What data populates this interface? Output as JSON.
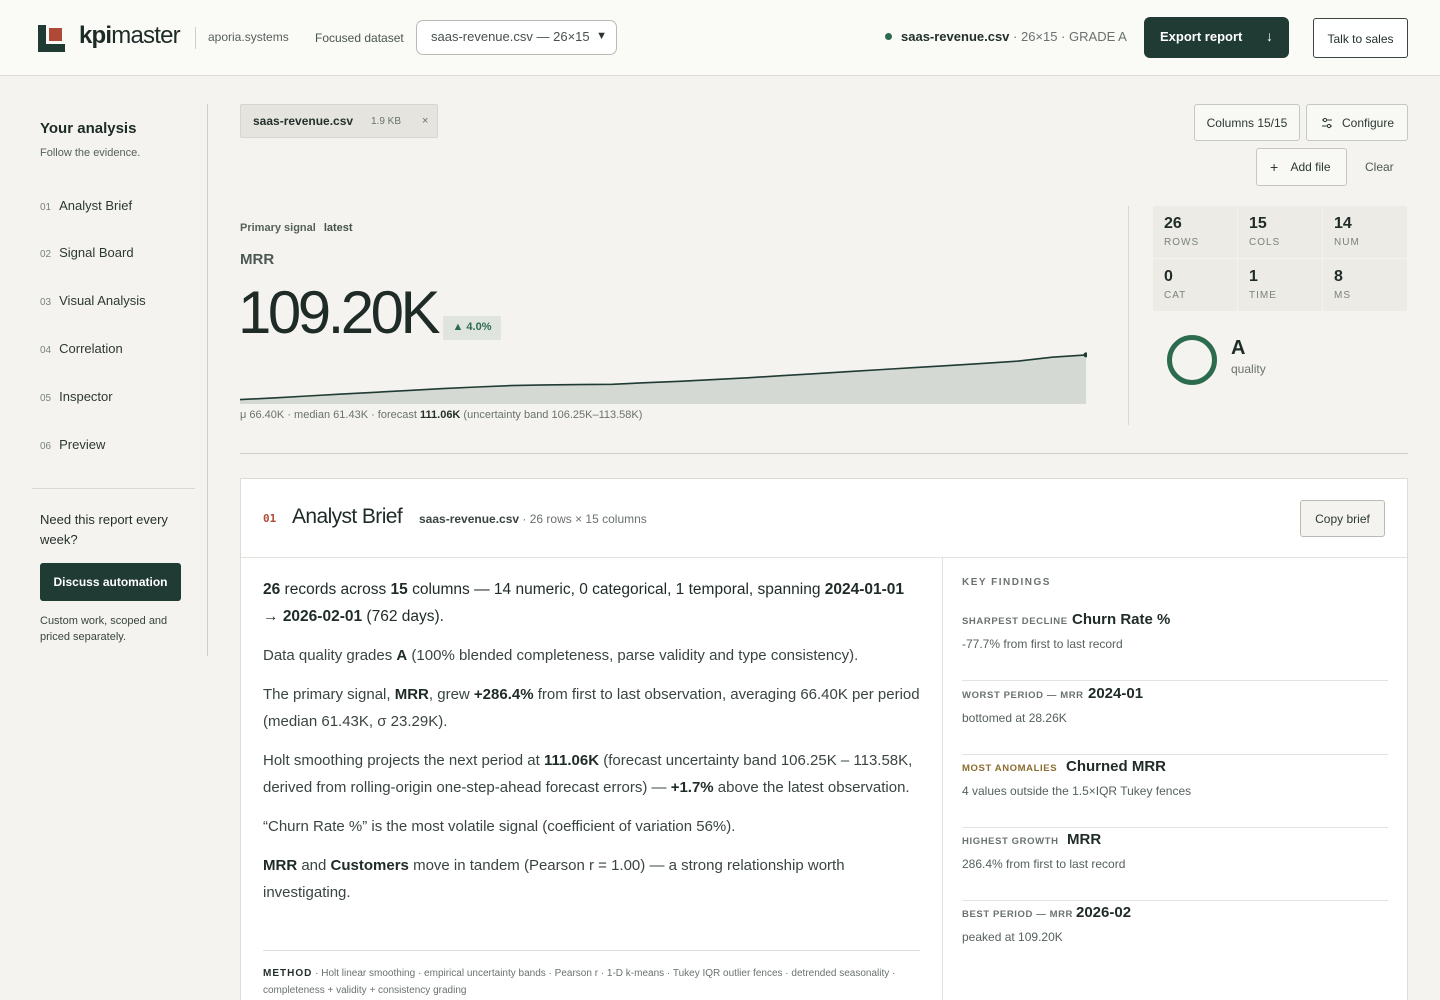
{
  "header": {
    "brand_bold": "kpi",
    "brand_rest": "master",
    "domain": "aporia.systems",
    "dataset_label": "Focused dataset",
    "dataset_selected": "saas-revenue.csv — 26×15",
    "status_file": "saas-revenue.csv",
    "status_meta": " · 26×15 · GRADE A",
    "export_label": "Export report",
    "sales_label": "Talk to sales",
    "colors": {
      "brand_dark": "#1f3b33",
      "accent_red": "#b04a38",
      "accent_green": "#2d6b4f"
    }
  },
  "sidebar": {
    "title": "Your analysis",
    "subtitle": "Follow the evidence.",
    "items": [
      {
        "num": "01",
        "label": "Analyst Brief"
      },
      {
        "num": "02",
        "label": "Signal Board"
      },
      {
        "num": "03",
        "label": "Visual Analysis"
      },
      {
        "num": "04",
        "label": "Correlation"
      },
      {
        "num": "05",
        "label": "Inspector"
      },
      {
        "num": "06",
        "label": "Preview"
      }
    ],
    "cta_text": "Need this report every week?",
    "cta_button": "Discuss automation",
    "cta_note": "Custom work, scoped and priced separately."
  },
  "files": {
    "chip_name": "saas-revenue.csv",
    "chip_size": "1.9 KB",
    "chip_close": "×",
    "columns_button": "Columns 15/15",
    "configure_button": "Configure",
    "add_file_button": "Add file",
    "clear_button": "Clear"
  },
  "primary_signal": {
    "label": "Primary signal",
    "tag": "latest",
    "metric": "MRR",
    "value": "109.20K",
    "delta": "▲ 4.0%",
    "foot_start": "μ 66.40K · median 61.43K · forecast ",
    "foot_forecast": "111.06K",
    "foot_end": " (uncertainty band 106.25K–113.58K)"
  },
  "chart_data": {
    "type": "area",
    "series": [
      {
        "values": [
          28.26,
          31.5,
          34.8,
          38.2,
          41.6,
          45.0,
          48.3,
          51.2,
          53.6,
          55.0,
          55.5,
          56.0,
          58.8,
          61.4,
          64.5,
          67.8,
          71.5,
          75.2,
          79.0,
          82.8,
          86.5,
          90.2,
          94.0,
          98.0,
          105.0,
          109.2
        ]
      }
    ],
    "ylim": [
      0,
      115
    ]
  },
  "stats": [
    {
      "value": "26",
      "label": "ROWS"
    },
    {
      "value": "15",
      "label": "COLS"
    },
    {
      "value": "14",
      "label": "NUM"
    },
    {
      "value": "0",
      "label": "CAT"
    },
    {
      "value": "1",
      "label": "TIME"
    },
    {
      "value": "8",
      "label": "MS"
    }
  ],
  "quality": {
    "grade": "A",
    "label": "quality"
  },
  "brief": {
    "num": "01",
    "title": "Analyst Brief",
    "meta_file": "saas-revenue.csv",
    "meta_rest": " · 26 rows × 15 columns",
    "copy_button": "Copy brief",
    "p1": {
      "a": "26",
      "b": " records across ",
      "c": "15",
      "d": " columns — 14 numeric, 0 categorical, 1 temporal, spanning ",
      "e": "2024-01-01",
      "f": " → ",
      "g": "2026-02-01",
      "h": " (762 days)."
    },
    "p2": {
      "a": "Data quality grades ",
      "b": "A",
      "c": " (100% blended completeness, parse validity and type consistency)."
    },
    "p3": {
      "a": "The primary signal, ",
      "b": "MRR",
      "c": ", grew ",
      "d": "+286.4%",
      "e": " from first to last observation, averaging 66.40K per period (median 61.43K, σ 23.29K)."
    },
    "p4": {
      "a": "Holt smoothing projects the next period at ",
      "b": "111.06K",
      "c": " (forecast uncertainty band 106.25K – 113.58K, derived from rolling-origin one-step-ahead forecast errors) — ",
      "d": "+1.7%",
      "e": " above the latest observation."
    },
    "p5": "“Churn Rate %” is the most volatile signal (coefficient of variation 56%).",
    "p6": {
      "a": "MRR",
      "b": " and ",
      "c": "Customers",
      "d": " move in tandem (Pearson r = 1.00) — a strong relationship worth investigating."
    },
    "method_label": "METHOD",
    "method_text": " · Holt linear smoothing · empirical uncertainty bands · Pearson r · 1-D k-means · Tukey IQR outlier fences · detrended seasonality · completeness + validity + consistency grading"
  },
  "key_findings": {
    "title": "KEY FINDINGS",
    "items": [
      {
        "tag": "SHARPEST DECLINE",
        "name": "Churn Rate %",
        "desc": "-77.7% from first to last record"
      },
      {
        "tag": "WORST PERIOD — MRR",
        "name": "2024-01",
        "desc": "bottomed at 28.26K"
      },
      {
        "tag": "MOST ANOMALIES",
        "name": "Churned MRR",
        "desc": "4 values outside the 1.5×IQR Tukey fences"
      },
      {
        "tag": "HIGHEST GROWTH",
        "name": "MRR",
        "desc": "286.4% from first to last record"
      },
      {
        "tag": "BEST PERIOD — MRR",
        "name": "2026-02",
        "desc": "peaked at 109.20K"
      }
    ]
  }
}
